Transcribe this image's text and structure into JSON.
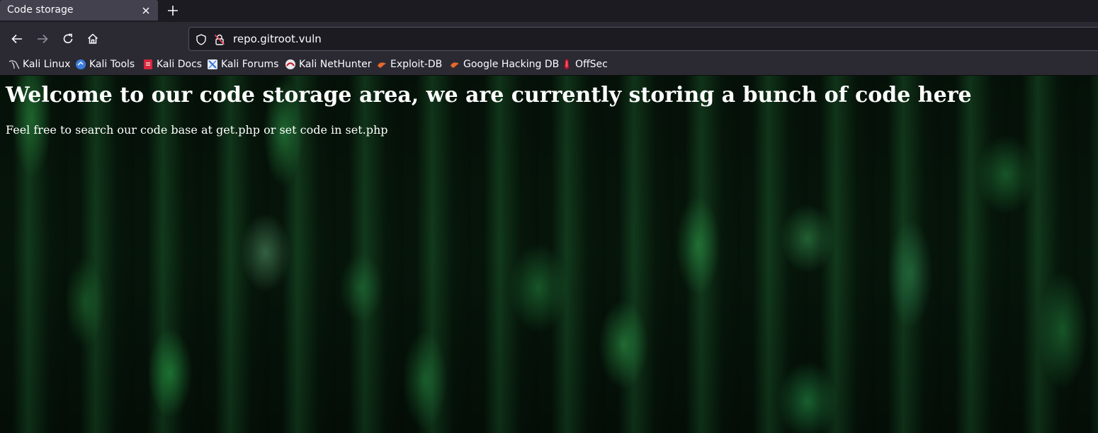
{
  "tab": {
    "title": "Code storage"
  },
  "address_bar": {
    "url": "repo.gitroot.vuln"
  },
  "bookmarks": [
    {
      "label": "Kali Linux",
      "icon": "kali-dragon-icon"
    },
    {
      "label": "Kali Tools",
      "icon": "kali-tools-icon"
    },
    {
      "label": "Kali Docs",
      "icon": "kali-docs-icon"
    },
    {
      "label": "Kali Forums",
      "icon": "kali-forums-icon"
    },
    {
      "label": "Kali NetHunter",
      "icon": "kali-nethunter-icon"
    },
    {
      "label": "Exploit-DB",
      "icon": "exploit-db-icon"
    },
    {
      "label": "Google Hacking DB",
      "icon": "google-hacking-db-icon"
    },
    {
      "label": "OffSec",
      "icon": "offsec-icon"
    }
  ],
  "page": {
    "heading": "Welcome to our code storage area, we are currently storing a bunch of code here",
    "text": "Feel free to search our code base at get.php or set code in set.php"
  },
  "colors": {
    "tab_active_bg": "#42414d",
    "toolbar_bg": "#2b2a33",
    "urlbar_bg": "#1c1b22",
    "background_green": "#0d2e16"
  }
}
